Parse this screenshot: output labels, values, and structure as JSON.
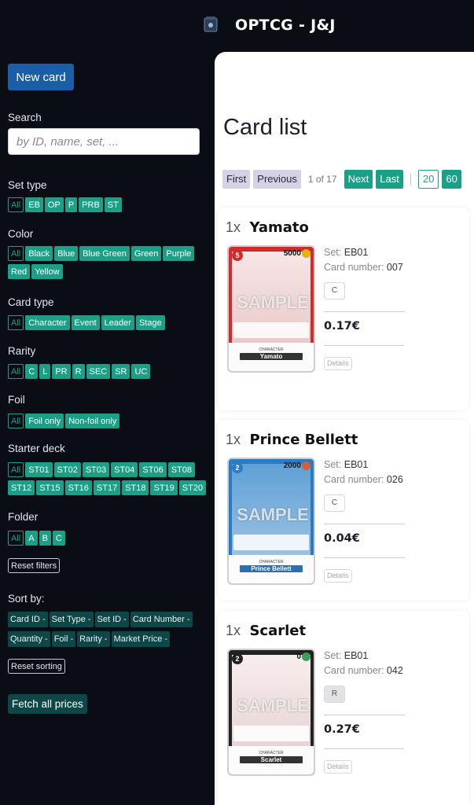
{
  "header": {
    "logo_icon": "card-box-icon",
    "title": "OPTCG - J&J"
  },
  "sidebar": {
    "new_card_label": "New card",
    "search": {
      "label": "Search",
      "placeholder": "by ID, name, set, ..."
    },
    "filters": [
      {
        "label": "Set type",
        "options": [
          "All",
          "EB",
          "OP",
          "P",
          "PRB",
          "ST"
        ]
      },
      {
        "label": "Color",
        "options": [
          "All",
          "Black",
          "Blue",
          "Blue Green",
          "Green",
          "Purple",
          "Red",
          "Yellow"
        ]
      },
      {
        "label": "Card type",
        "options": [
          "All",
          "Character",
          "Event",
          "Leader",
          "Stage"
        ]
      },
      {
        "label": "Rarity",
        "options": [
          "All",
          "C",
          "L",
          "PR",
          "R",
          "SEC",
          "SR",
          "UC"
        ]
      },
      {
        "label": "Foil",
        "options": [
          "All",
          "Foil only",
          "Non-foil only"
        ]
      },
      {
        "label": "Starter deck",
        "options": [
          "All",
          "ST01",
          "ST02",
          "ST03",
          "ST04",
          "ST06",
          "ST08",
          "ST12",
          "ST15",
          "ST16",
          "ST17",
          "ST18",
          "ST19",
          "ST20"
        ]
      },
      {
        "label": "Folder",
        "options": [
          "All",
          "A",
          "B",
          "C"
        ]
      }
    ],
    "reset_filters_label": "Reset filters",
    "sort": {
      "label": "Sort by:",
      "rows": [
        [
          "Card ID -",
          "Set Type -",
          "Set ID -",
          "Card Number -"
        ],
        [
          "Quantity -",
          "Foil -",
          "Rarity -",
          "Market Price -"
        ]
      ]
    },
    "reset_sorting_label": "Reset sorting",
    "fetch_prices_label": "Fetch all prices"
  },
  "main": {
    "title": "Card list",
    "pagination": {
      "first": "First",
      "previous": "Previous",
      "info": "1 of 17",
      "next": "Next",
      "last": "Last",
      "sizes": [
        "20",
        "60"
      ]
    },
    "cards": [
      {
        "qty": "1x",
        "name": "Yamato",
        "set": "EB01",
        "number": "007",
        "rarity": "C",
        "price": "0.17€",
        "cost": "5",
        "power": "5000",
        "card_name": "Yamato",
        "type_line": "CHARACTER",
        "color": "#d42a2a",
        "art": "#f3d9d9"
      },
      {
        "qty": "1x",
        "name": "Prince Bellett",
        "set": "EB01",
        "number": "026",
        "rarity": "C",
        "price": "0.04€",
        "cost": "2",
        "power": "2000",
        "card_name": "Prince Bellett",
        "type_line": "CHARACTER",
        "color": "#2a7cc2",
        "art": "#7fb0d8"
      },
      {
        "qty": "1x",
        "name": "Scarlet",
        "set": "EB01",
        "number": "042",
        "rarity": "R",
        "price": "0.27€",
        "cost": "2",
        "power": "0",
        "card_name": "Scarlet",
        "type_line": "CHARACTER",
        "color": "#222222",
        "art": "#f0e2e2"
      }
    ],
    "labels": {
      "set": "Set:",
      "card_number": "Card number:",
      "sample": "SAMPLE",
      "details": "Details"
    }
  }
}
